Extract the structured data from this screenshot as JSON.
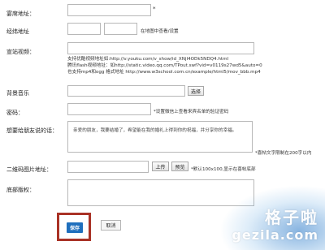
{
  "form": {
    "wedding_address": {
      "label": "宴席地址：",
      "required_mark": "*"
    },
    "coordinates": {
      "label": "经纬地址",
      "hint": "在地图中查看/设置"
    },
    "video": {
      "label": "宣站视频：",
      "help": [
        "支持优酷视频地址如:http://v.youku.com/v_show/id_XNjI4ODk5NDQ4.html",
        "腾讯flash视频地址：如http://static.video.qq.com/TPout.swf?vid=v0119s27wd5&auto=0",
        "也支持mp4和ogg 格式地址 http://www.w3school.com.cn/example/html5/mov_bbb.mp4"
      ]
    },
    "music": {
      "label": "背景音乐",
      "select_button": "选择"
    },
    "password": {
      "label": "密码：",
      "hint": "*设置微信上查看来宾名单的验证密码"
    },
    "message": {
      "label": "想要给朋友说的话：",
      "value": "亲爱的朋友，我要结婚了，希望能在我的婚礼上得到你的祝福，并分享你的幸福。",
      "hint": "*喜帖文字限制在200字以内"
    },
    "qrcode": {
      "label": "二维码图片地址：",
      "upload_button": "上传",
      "preview_button": "预览",
      "hint": "*默认100x100,显示在喜帖底部"
    },
    "footer": {
      "label": "底部版权："
    }
  },
  "actions": {
    "save": "保存",
    "cancel": "取消"
  },
  "watermark": {
    "line1": "格子啦",
    "line2": "gezila.com"
  },
  "colors": {
    "save_button": "#1f6fbd",
    "highlight_border": "#a93226"
  }
}
